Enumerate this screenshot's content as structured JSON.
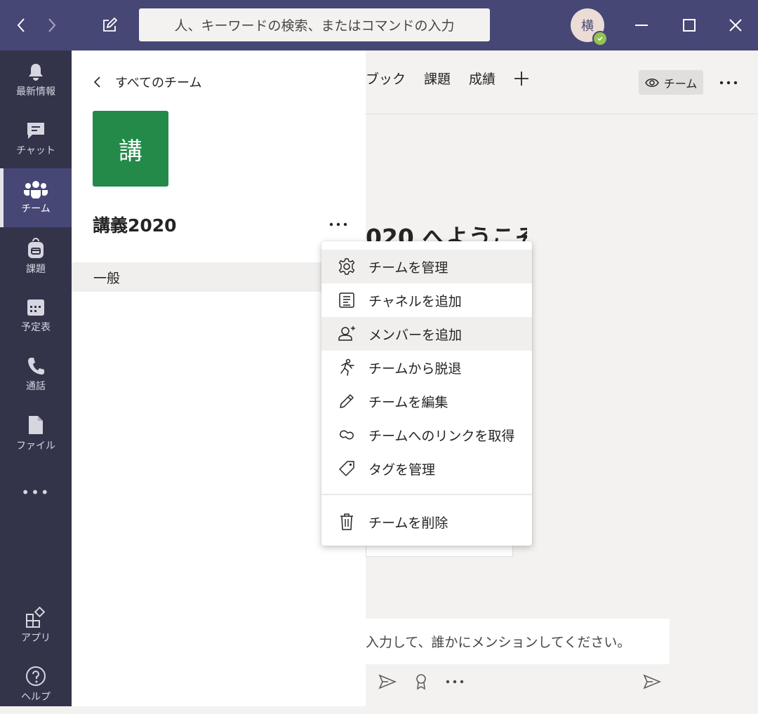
{
  "search": {
    "placeholder": "人、キーワードの検索、またはコマンドの入力"
  },
  "user": {
    "avatar_initial": "横",
    "status": "available"
  },
  "rail": {
    "items": [
      {
        "label": "最新情報",
        "icon": "bell-icon"
      },
      {
        "label": "チャット",
        "icon": "chat-icon"
      },
      {
        "label": "チーム",
        "icon": "teams-icon",
        "active": true
      },
      {
        "label": "課題",
        "icon": "backpack-icon"
      },
      {
        "label": "予定表",
        "icon": "calendar-icon"
      },
      {
        "label": "通話",
        "icon": "phone-icon"
      },
      {
        "label": "ファイル",
        "icon": "file-icon"
      }
    ],
    "more": "•••",
    "apps_label": "アプリ",
    "help_label": "ヘルプ"
  },
  "team_panel": {
    "back_label": "すべてのチーム",
    "tile_char": "講",
    "team_name": "講義2020",
    "channel": "一般"
  },
  "main": {
    "tabs": [
      "ブック",
      "課題",
      "成績"
    ],
    "team_view_label": "チーム",
    "welcome": "020 へようこそ",
    "compose_placeholder": "入力して、誰かにメンションしてください。"
  },
  "context_menu": {
    "items": [
      {
        "label": "チームを管理",
        "icon": "gear-icon"
      },
      {
        "label": "チャネルを追加",
        "icon": "add-channel-icon"
      },
      {
        "label": "メンバーを追加",
        "icon": "add-member-icon"
      },
      {
        "label": "チームから脱退",
        "icon": "leave-icon"
      },
      {
        "label": "チームを編集",
        "icon": "pencil-icon"
      },
      {
        "label": "チームへのリンクを取得",
        "icon": "link-icon"
      },
      {
        "label": "タグを管理",
        "icon": "tag-icon"
      }
    ],
    "delete_label": "チームを削除"
  },
  "colors": {
    "topbar": "#464775",
    "rail": "#33344a",
    "tile": "#238a4a"
  }
}
